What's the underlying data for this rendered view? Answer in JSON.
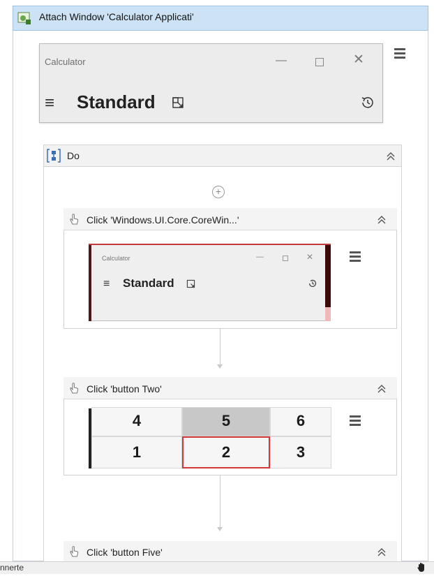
{
  "attach": {
    "title": "Attach Window 'Calculator Applicati'",
    "icon": "attach-window-icon"
  },
  "calculator_preview": {
    "title": "Calculator",
    "mode": "Standard",
    "minimize": "—",
    "close": "✕",
    "hamburger": "≡"
  },
  "sequence": {
    "title": "Do"
  },
  "activities": [
    {
      "title": "Click 'Windows.UI.Core.CoreWin...'",
      "preview": {
        "title": "Calculator",
        "mode": "Standard",
        "minimize": "—",
        "close": "✕",
        "hamburger": "≡"
      }
    },
    {
      "title": "Click 'button  Two'",
      "keys_top": [
        "4",
        "5",
        "6"
      ],
      "keys_bottom": [
        "1",
        "2",
        "3"
      ],
      "selected_key": "2"
    },
    {
      "title": "Click 'button  Five'"
    }
  ],
  "status": {
    "left_text": "nnerte"
  },
  "colors": {
    "header_blue": "#cde3f5",
    "selection_red": "#d23a3a"
  }
}
